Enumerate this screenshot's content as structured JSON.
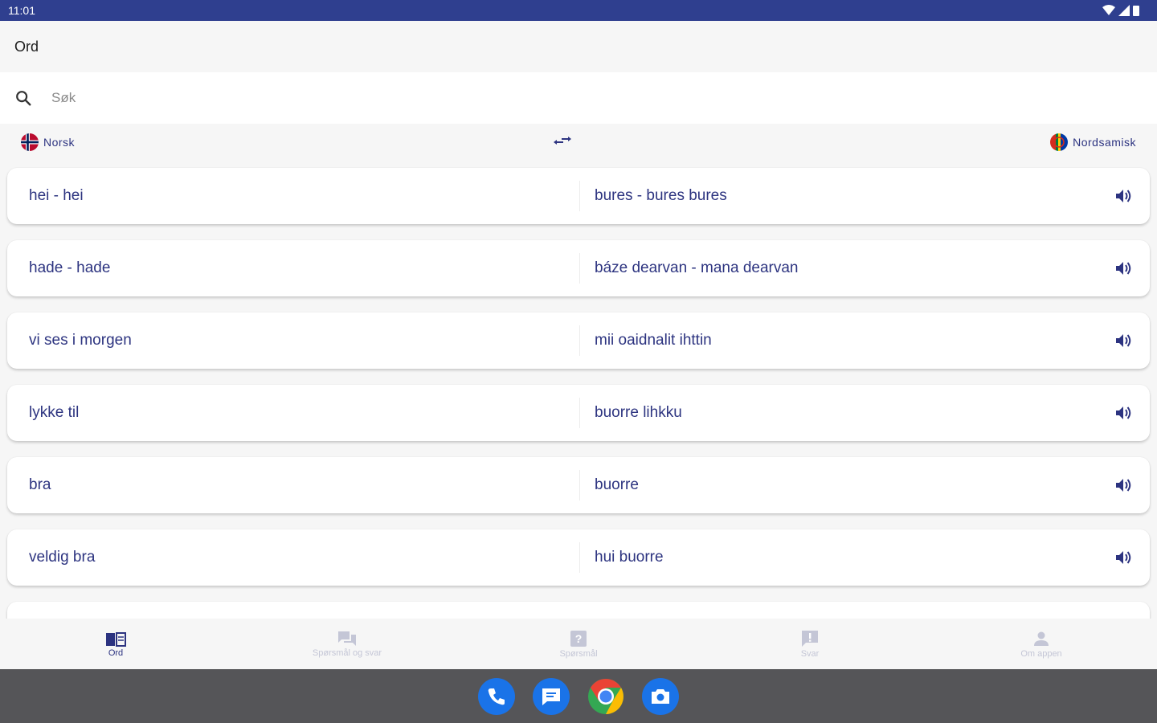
{
  "status": {
    "time": "11:01"
  },
  "topbar": {
    "title": "Ord"
  },
  "search": {
    "placeholder": "Søk"
  },
  "languages": {
    "source": "Norsk",
    "target": "Nordsamisk"
  },
  "entries": [
    {
      "norsk": "hei - hei",
      "samisk": "bures - bures bures"
    },
    {
      "norsk": "hade - hade",
      "samisk": "báze dearvan - mana dearvan"
    },
    {
      "norsk": "vi ses i morgen",
      "samisk": "mii oaidnalit ihttin"
    },
    {
      "norsk": "lykke til",
      "samisk": "buorre lihkku"
    },
    {
      "norsk": "bra",
      "samisk": "buorre"
    },
    {
      "norsk": "veldig bra",
      "samisk": "hui buorre"
    },
    {
      "norsk": "",
      "samisk": ""
    }
  ],
  "bottom_nav": [
    {
      "label": "Ord",
      "icon": "book-icon",
      "active": true
    },
    {
      "label": "Spørsmål og svar",
      "icon": "forum-icon",
      "active": false
    },
    {
      "label": "Spørsmål",
      "icon": "question-icon",
      "active": false
    },
    {
      "label": "Svar",
      "icon": "answer-icon",
      "active": false
    },
    {
      "label": "Om appen",
      "icon": "person-icon",
      "active": false
    }
  ],
  "dock": [
    "phone-icon",
    "messages-icon",
    "chrome-icon",
    "camera-icon"
  ],
  "colors": {
    "statusbar": "#2f3f8f",
    "accent": "#2c3380",
    "dock": "#555558"
  }
}
